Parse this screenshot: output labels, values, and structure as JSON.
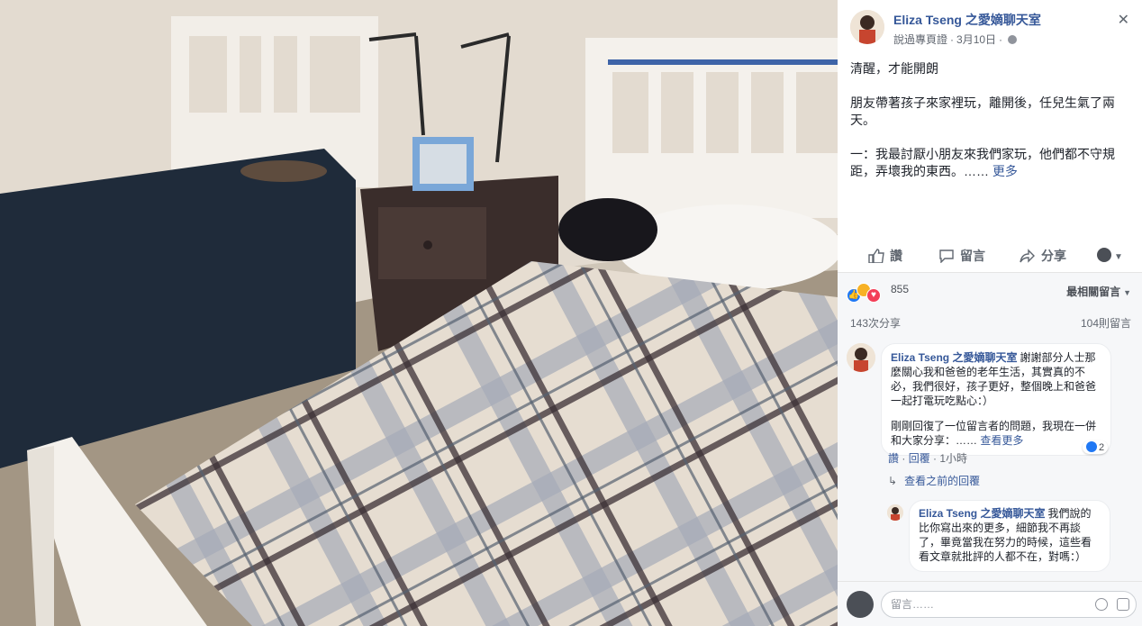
{
  "post": {
    "author": "Eliza Tseng 之愛嫡聊天室",
    "sponsor_label": "說過專頁證",
    "date": "3月10日",
    "close_glyph": "✕",
    "paragraph_1": "清醒，才能開朗",
    "paragraph_2": "朋友帶著孩子來家裡玩，離開後，任兒生氣了兩天。",
    "paragraph_3": "一：我最討厭小朋友來我們家玩，他們都不守規距，弄壞我的東西。……",
    "more_label": "更多"
  },
  "actions": {
    "like": "讚",
    "comment": "留言",
    "share": "分享"
  },
  "stats": {
    "reaction_count": "855",
    "sort_label": "最相關留言",
    "shares": "143次分享",
    "comments": "104則留言"
  },
  "comments": [
    {
      "author": "Eliza Tseng 之愛嫡聊天室",
      "text_1": "謝謝部分人士那麼關心我和爸爸的老年生活，其實真的不必，我們很好，孩子更好，整個晚上和爸爸一起打電玩吃點心：）",
      "text_2": "剛剛回復了一位留言者的問題，我現在一併和大家分享：……",
      "more_label": "查看更多",
      "like_label": "讚",
      "reply_label": "回覆",
      "time": "1小時",
      "like_count": "2"
    },
    {
      "author": "Eliza Tseng 之愛嫡聊天室",
      "text": "我們說的比你寫出來的更多，細節我不再談了，畢竟當我在努力的時候，這些看看文章就批評的人都不在，對嗎：）"
    }
  ],
  "view_previous": "查看之前的回覆",
  "composer": {
    "placeholder": "留言……"
  },
  "colors": {
    "link_blue": "#365899",
    "like_blue": "#2078f4",
    "panel_bg": "#f6f7f9"
  }
}
